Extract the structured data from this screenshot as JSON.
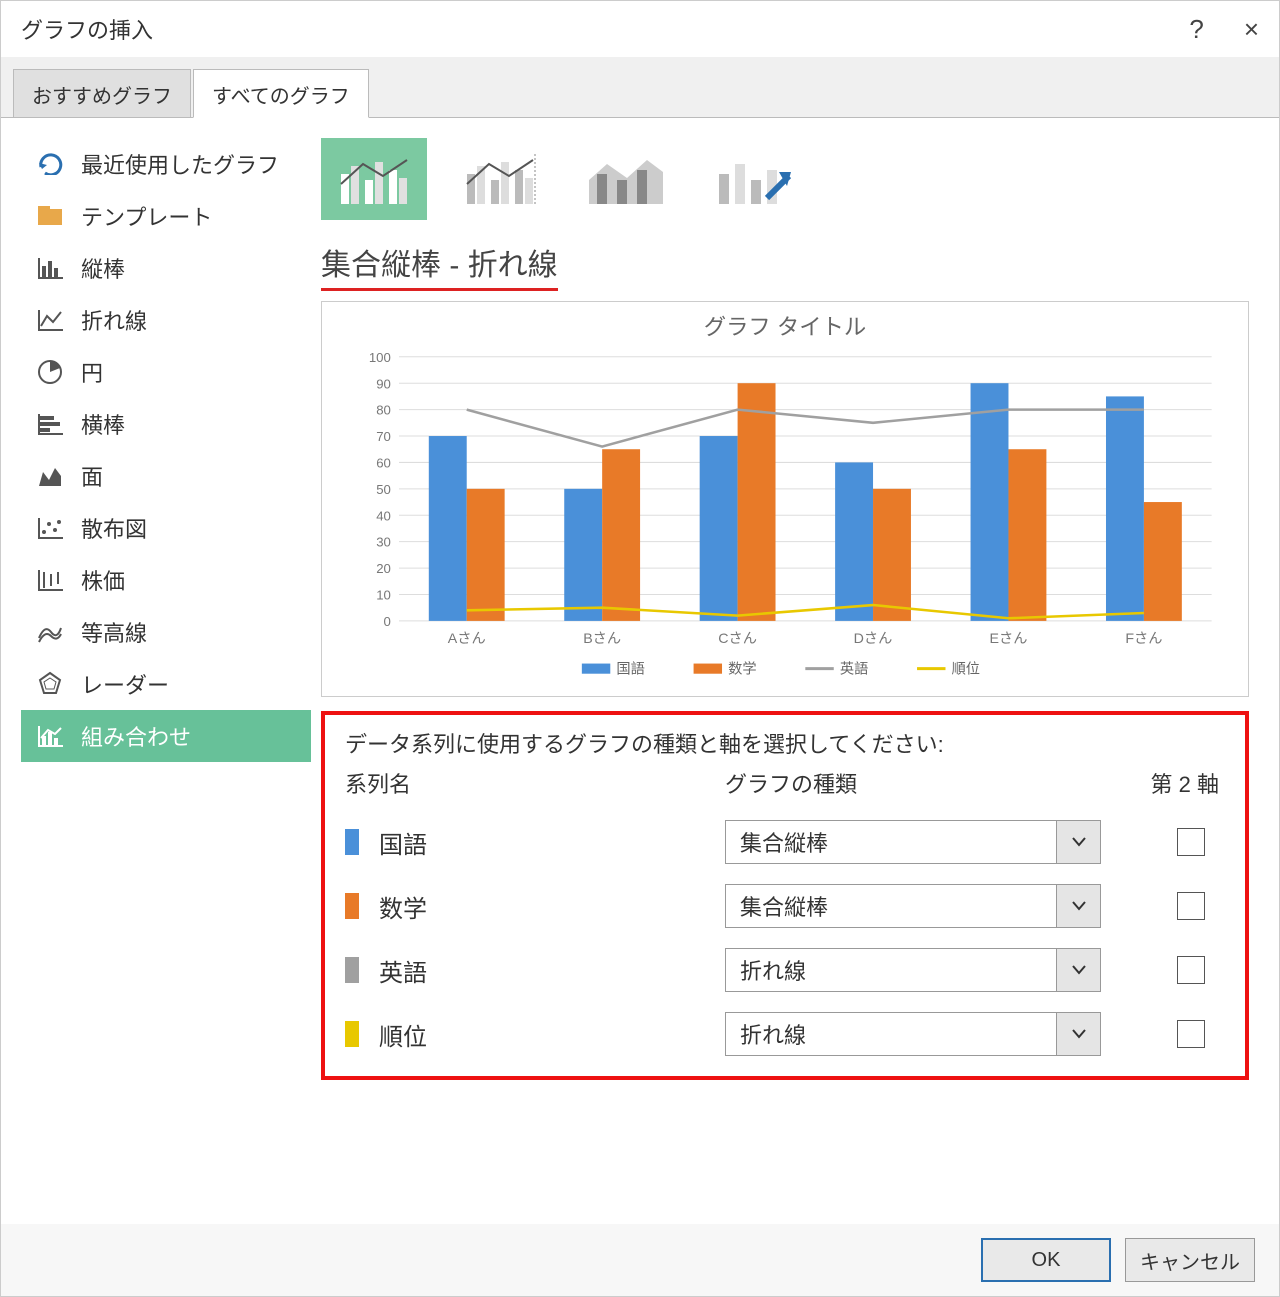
{
  "dialog": {
    "title": "グラフの挿入",
    "help": "?",
    "close": "×"
  },
  "tabs": [
    {
      "label": "おすすめグラフ",
      "active": false
    },
    {
      "label": "すべてのグラフ",
      "active": true
    }
  ],
  "sidebar": {
    "items": [
      {
        "icon": "recent-icon",
        "label": "最近使用したグラフ"
      },
      {
        "icon": "template-icon",
        "label": "テンプレート"
      },
      {
        "icon": "column-chart-icon",
        "label": "縦棒"
      },
      {
        "icon": "line-chart-icon",
        "label": "折れ線"
      },
      {
        "icon": "pie-chart-icon",
        "label": "円"
      },
      {
        "icon": "bar-chart-icon",
        "label": "横棒"
      },
      {
        "icon": "area-chart-icon",
        "label": "面"
      },
      {
        "icon": "scatter-chart-icon",
        "label": "散布図"
      },
      {
        "icon": "stock-chart-icon",
        "label": "株価"
      },
      {
        "icon": "surface-chart-icon",
        "label": "等高線"
      },
      {
        "icon": "radar-chart-icon",
        "label": "レーダー"
      },
      {
        "icon": "combo-chart-icon",
        "label": "組み合わせ",
        "selected": true
      }
    ]
  },
  "subtype": {
    "options": [
      "clustered-column-line",
      "clustered-column-line-secondary",
      "stacked-area-column",
      "custom-combination"
    ],
    "selected": 0,
    "heading": "集合縦棒 - 折れ線"
  },
  "chart_data": {
    "type": "bar",
    "title": "グラフ タイトル",
    "categories": [
      "Aさん",
      "Bさん",
      "Cさん",
      "Dさん",
      "Eさん",
      "Fさん"
    ],
    "series": [
      {
        "name": "国語",
        "type": "bar",
        "color": "#4a90d9",
        "values": [
          70,
          50,
          70,
          60,
          90,
          85
        ]
      },
      {
        "name": "数学",
        "type": "bar",
        "color": "#e87a28",
        "values": [
          50,
          65,
          90,
          50,
          65,
          45
        ]
      },
      {
        "name": "英語",
        "type": "line",
        "color": "#a0a0a0",
        "values": [
          80,
          66,
          80,
          75,
          80,
          80
        ]
      },
      {
        "name": "順位",
        "type": "line",
        "color": "#e8c800",
        "values": [
          4,
          5,
          2,
          6,
          1,
          3
        ]
      }
    ],
    "ylim": [
      0,
      100
    ],
    "yticks": [
      0,
      10,
      20,
      30,
      40,
      50,
      60,
      70,
      80,
      90,
      100
    ],
    "xlabel": "",
    "ylabel": ""
  },
  "series_panel": {
    "instruction": "データ系列に使用するグラフの種類と軸を選択してください:",
    "header": {
      "name": "系列名",
      "type": "グラフの種類",
      "axis": "第 2 軸"
    },
    "rows": [
      {
        "color": "#4a90d9",
        "name": "国語",
        "chart_type": "集合縦棒",
        "secondary_axis": false
      },
      {
        "color": "#e87a28",
        "name": "数学",
        "chart_type": "集合縦棒",
        "secondary_axis": false
      },
      {
        "color": "#a0a0a0",
        "name": "英語",
        "chart_type": "折れ線",
        "secondary_axis": false
      },
      {
        "color": "#e8c800",
        "name": "順位",
        "chart_type": "折れ線",
        "secondary_axis": false
      }
    ]
  },
  "buttons": {
    "ok": "OK",
    "cancel": "キャンセル"
  }
}
